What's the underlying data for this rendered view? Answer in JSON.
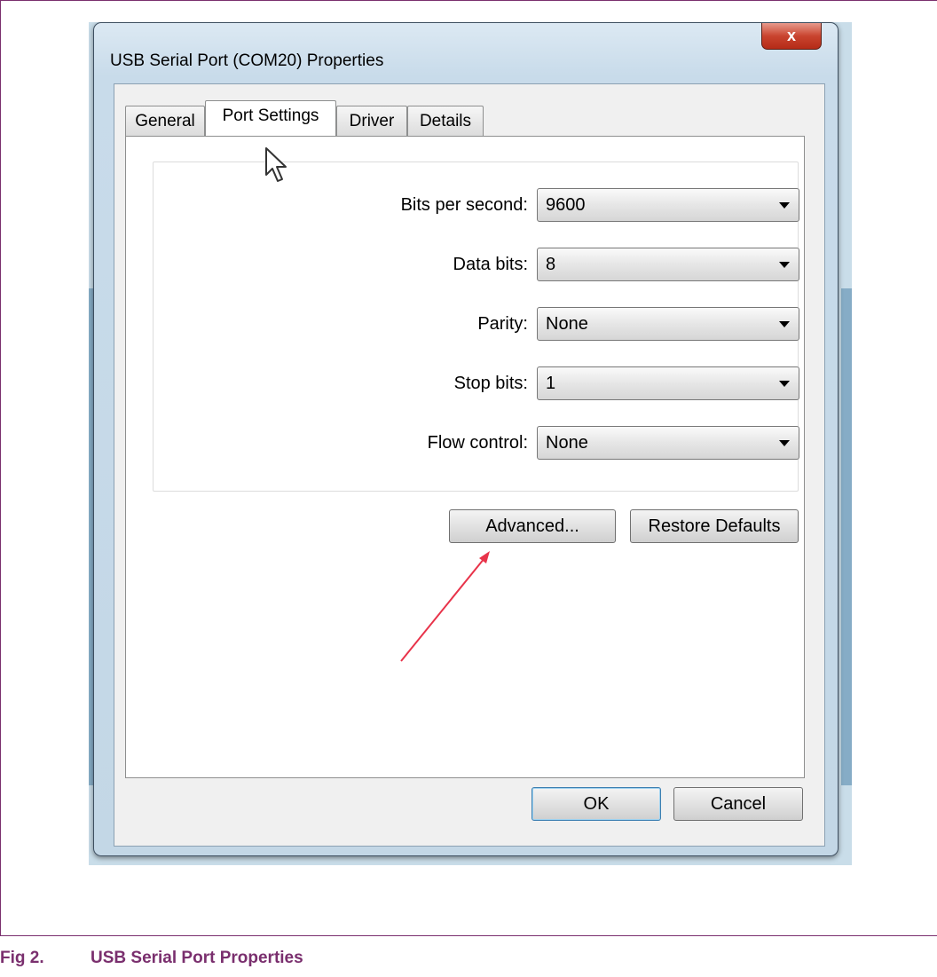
{
  "window": {
    "title": "USB Serial Port (COM20) Properties",
    "close_label": "x"
  },
  "tabs": [
    {
      "label": "General",
      "active": false
    },
    {
      "label": "Port Settings",
      "active": true
    },
    {
      "label": "Driver",
      "active": false
    },
    {
      "label": "Details",
      "active": false
    }
  ],
  "settings": [
    {
      "label": "Bits per second:",
      "value": "9600"
    },
    {
      "label": "Data bits:",
      "value": "8"
    },
    {
      "label": "Parity:",
      "value": "None"
    },
    {
      "label": "Stop bits:",
      "value": "1"
    },
    {
      "label": "Flow control:",
      "value": "None"
    }
  ],
  "buttons": {
    "advanced": "Advanced...",
    "restore_defaults": "Restore Defaults",
    "ok": "OK",
    "cancel": "Cancel"
  },
  "caption": {
    "number": "Fig 2.",
    "text": "USB Serial Port Properties"
  },
  "colors": {
    "caption": "#7a2f6e",
    "annotation_arrow": "#e8334a",
    "close_button": "#c9442f"
  }
}
